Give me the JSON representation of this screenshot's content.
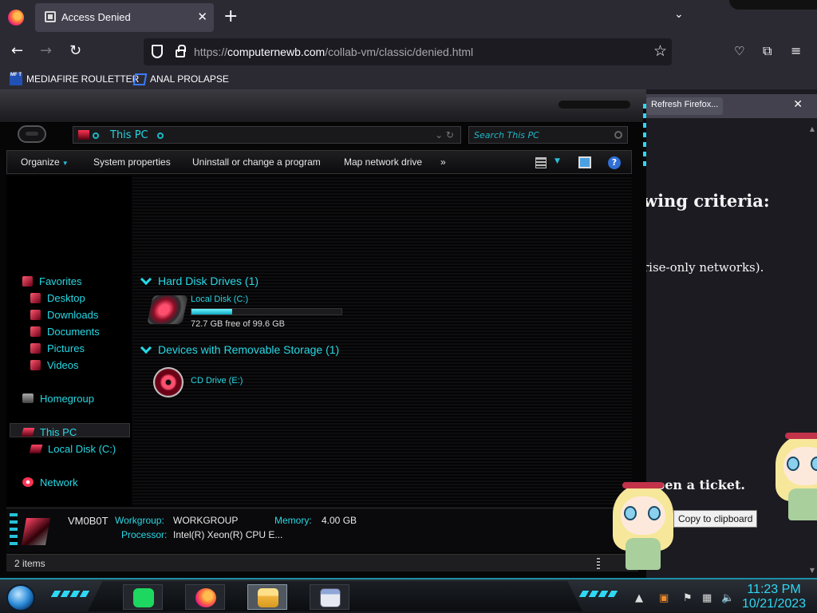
{
  "browser": {
    "tab_title": "Access Denied",
    "url_prefix": "https://",
    "url_domain": "computernewb.com",
    "url_path": "/collab-vm/classic/denied.html",
    "bookmarks": [
      {
        "label": "MEDIAFIRE ROULETTER",
        "icon": "mediafire-icon",
        "icon_text": "MF T"
      },
      {
        "label": "ANAL PROLAPSE",
        "icon": "bookmark-icon"
      }
    ],
    "notification_button": "Refresh Firefox...",
    "page_fragments": [
      "wing criteria:",
      "rise-only networks).",
      "pen a ticket."
    ]
  },
  "explorer": {
    "address": "This PC",
    "search_placeholder": "Search This PC",
    "commands": [
      "Organize",
      "System properties",
      "Uninstall or change a program",
      "Map network drive",
      "»"
    ],
    "nav": {
      "favorites": "Favorites",
      "favorites_items": [
        "Desktop",
        "Downloads",
        "Documents",
        "Pictures",
        "Videos"
      ],
      "homegroup": "Homegroup",
      "this_pc": "This PC",
      "this_pc_items": [
        "Local Disk (C:)"
      ],
      "network": "Network"
    },
    "groups": {
      "hdd_header": "Hard Disk Drives (1)",
      "removable_header": "Devices with Removable Storage (1)"
    },
    "drives": {
      "c_name": "Local Disk (C:)",
      "c_free": "72.7 GB free of 99.6 GB",
      "c_used_fraction": 0.27,
      "e_name": "CD Drive (E:)"
    },
    "details": {
      "computer_name": "VM0B0T",
      "workgroup_label": "Workgroup:",
      "workgroup_value": "WORKGROUP",
      "memory_label": "Memory:",
      "memory_value": "4.00 GB",
      "processor_label": "Processor:",
      "processor_value": "Intel(R) Xeon(R) CPU E..."
    },
    "status": "2 items"
  },
  "tooltip": "Copy to clipboard",
  "taskbar": {
    "time": "11:23 PM",
    "date": "10/21/2023",
    "apps": [
      "spotify-icon",
      "firefox-icon",
      "file-explorer-icon",
      "window-icon"
    ]
  },
  "colors": {
    "accent": "#27d8e4",
    "browser_bg": "#1c1b22",
    "chrome": "#2b2a33"
  }
}
